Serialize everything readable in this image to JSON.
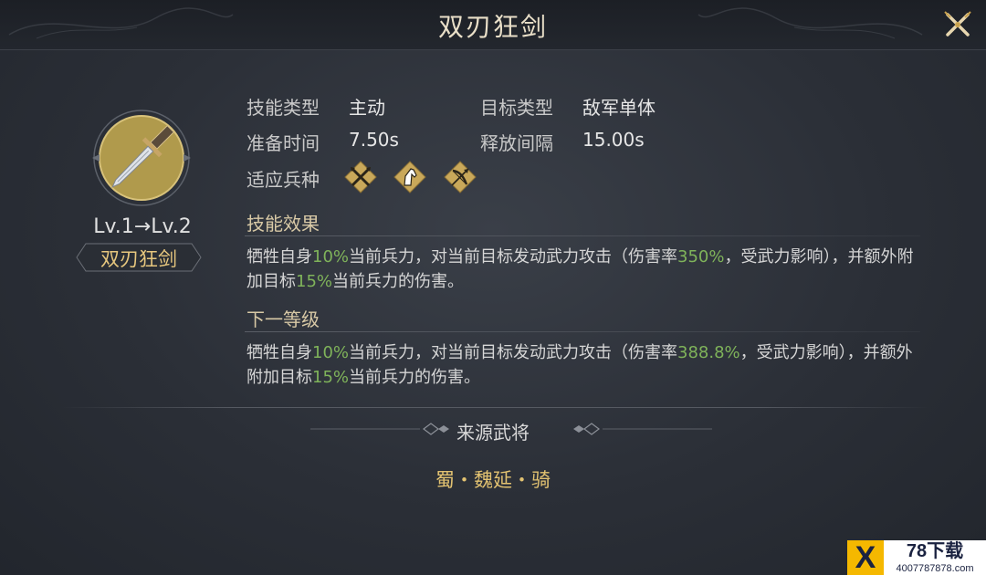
{
  "header": {
    "title": "双刃狂剑"
  },
  "skill": {
    "level_text": "Lv.1→Lv.2",
    "name": "双刃狂剑"
  },
  "info": {
    "skill_type_label": "技能类型",
    "skill_type_value": "主动",
    "target_type_label": "目标类型",
    "target_type_value": "敌军单体",
    "prep_time_label": "准备时间",
    "prep_time_value": "7.50s",
    "cooldown_label": "释放间隔",
    "cooldown_value": "15.00s",
    "troops_label": "适应兵种",
    "troop_icons": [
      "crossed-spears-icon",
      "horse-head-icon",
      "bow-icon"
    ]
  },
  "effect": {
    "title": "技能效果",
    "segments": [
      "牺牲自身",
      "10%",
      "当前兵力，对当前目标发动武力攻击（伤害率",
      "350%",
      "，受武力影响），并额外附加目标",
      "15%",
      "当前兵力的伤害。"
    ]
  },
  "next_level": {
    "title": "下一等级",
    "segments": [
      "牺牲自身",
      "10%",
      "当前兵力，对当前目标发动武力攻击（伤害率",
      "388.8%",
      "，受武力影响），并额外附加目标",
      "15%",
      "当前兵力的伤害。"
    ]
  },
  "source": {
    "title": "来源武将",
    "general": "蜀・魏延・骑"
  },
  "watermark": {
    "logo_letter": "X",
    "name": "78下载",
    "url": "4007787878.com"
  },
  "colors": {
    "highlight_green": "#7fb35a",
    "gold": "#e2c271",
    "title": "#e9dfc8"
  }
}
